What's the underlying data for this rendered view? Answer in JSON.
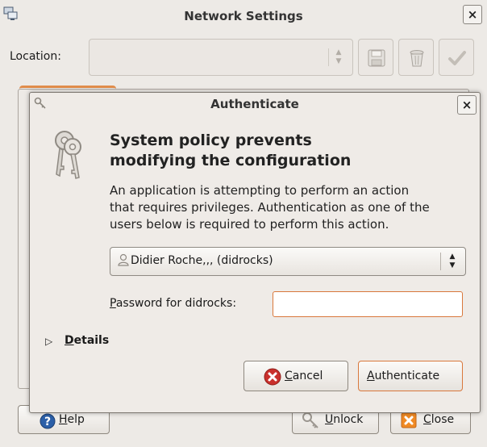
{
  "parent": {
    "title": "Network Settings",
    "close_glyph": "×",
    "location_label": "Location:",
    "location_value": "",
    "icons": {
      "app": "network-settings-icon",
      "save": "floppy-disk-icon",
      "delete": "trash-can-icon",
      "apply": "checkmark-icon"
    },
    "buttons": {
      "help": {
        "icon": "help-icon",
        "mnemonic": "H",
        "rest": "elp"
      },
      "unlock": {
        "icon": "keys-icon",
        "mnemonic": "U",
        "rest": "nlock"
      },
      "close": {
        "icon": "close-x-icon",
        "mnemonic": "C",
        "rest": "lose"
      }
    }
  },
  "dialog": {
    "title": "Authenticate",
    "close_glyph": "×",
    "heading_line1": "System policy prevents",
    "heading_line2": "modifying the configuration",
    "body_line1": "An application is attempting to perform an action",
    "body_line2": "that requires privileges. Authentication as one of the",
    "body_line3": "users below is required to perform this action.",
    "user": "Didier Roche,,, (didrocks)",
    "password_label": {
      "mnemonic": "P",
      "rest": "assword for didrocks:"
    },
    "password_value": "",
    "details": {
      "mnemonic": "D",
      "rest": "etails"
    },
    "cancel": {
      "mnemonic": "C",
      "rest": "ancel"
    },
    "authenticate": {
      "mnemonic": "A",
      "rest": "uthenticate"
    },
    "colors": {
      "focus_border": "#d9783c",
      "cancel_icon_red": "#c9302c"
    }
  }
}
